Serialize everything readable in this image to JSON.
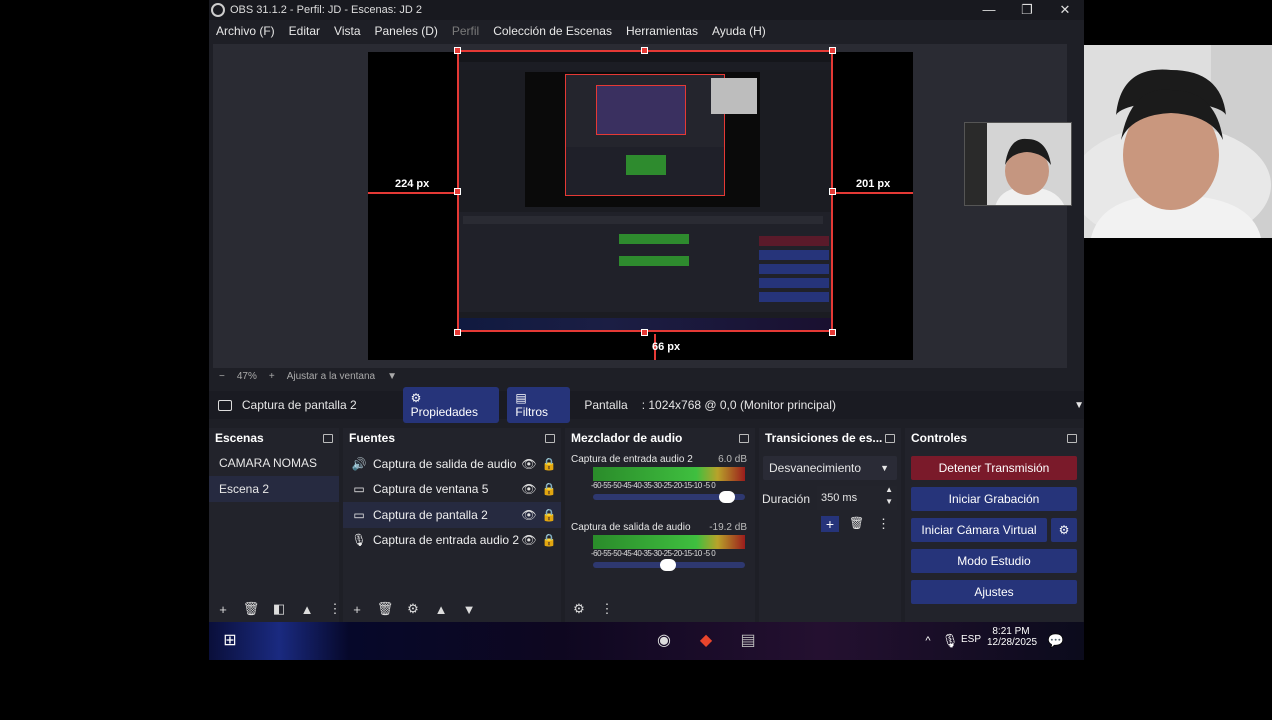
{
  "window": {
    "title": "OBS 31.1.2 - Perfil: JD - Escenas: JD 2",
    "minimize": "—",
    "maximize": "❐",
    "close": "✕"
  },
  "menu": [
    "Archivo (F)",
    "Editar",
    "Vista",
    "Paneles (D)",
    "Perfil",
    "Colección de Escenas",
    "Herramientas",
    "Ayuda (H)"
  ],
  "preview": {
    "left_px": "224 px",
    "right_px": "201 px",
    "bottom_px": "66 px"
  },
  "zoom": {
    "minus": "−",
    "value": "47%",
    "plus": "+",
    "fit": "Ajustar a la ventana",
    "arrow": "▼"
  },
  "source_bar": {
    "name": "Captura de pantalla 2",
    "properties": "Propiedades",
    "filters": "Filtros",
    "label": "Pantalla",
    "value": ": 1024x768 @ 0,0 (Monitor principal)"
  },
  "scenes": {
    "title": "Escenas",
    "items": [
      "CAMARA NOMAS",
      "Escena 2"
    ],
    "selected": 1
  },
  "sources": {
    "title": "Fuentes",
    "items": [
      {
        "label": "Captura de salida de audio",
        "icon": "speaker-icon",
        "glyph": "🔊"
      },
      {
        "label": "Captura de ventana 5",
        "icon": "window-icon",
        "glyph": "▭"
      },
      {
        "label": "Captura de pantalla 2",
        "icon": "monitor-icon",
        "glyph": "🖵"
      },
      {
        "label": "Captura de entrada audio 2",
        "icon": "microphone-icon",
        "glyph": "🎙"
      }
    ],
    "selected": 2
  },
  "mixer": {
    "title": "Mezclador de audio",
    "channels": [
      {
        "name": "Captura de entrada audio 2",
        "db": "6.0 dB",
        "ticks": "-60-55-50-45-40-35-30-25-20-15-10 -5  0",
        "volume": 0.93
      },
      {
        "name": "Captura de salida de audio",
        "db": "-19.2 dB",
        "ticks": "-60-55-50-45-40-35-30-25-20-15-10 -5  0",
        "volume": 0.49
      }
    ]
  },
  "transitions": {
    "title": "Transiciones de es...",
    "selected": "Desvanecimiento",
    "duration_label": "Duración",
    "duration_value": "350 ms"
  },
  "controls": {
    "title": "Controles",
    "stop_stream": "Detener Transmisión",
    "start_recording": "Iniciar Grabación",
    "virtual_camera": "Iniciar Cámara Virtual",
    "studio_mode": "Modo Estudio",
    "settings": "Ajustes"
  },
  "taskbar": {
    "time": "8:21 PM",
    "date": "12/28/2025",
    "lang": "ESP",
    "notifications": "2"
  },
  "colors": {
    "accent_blue": "#26347a",
    "stop_red": "#7a1a2a",
    "bounding_red": "#e53935"
  }
}
